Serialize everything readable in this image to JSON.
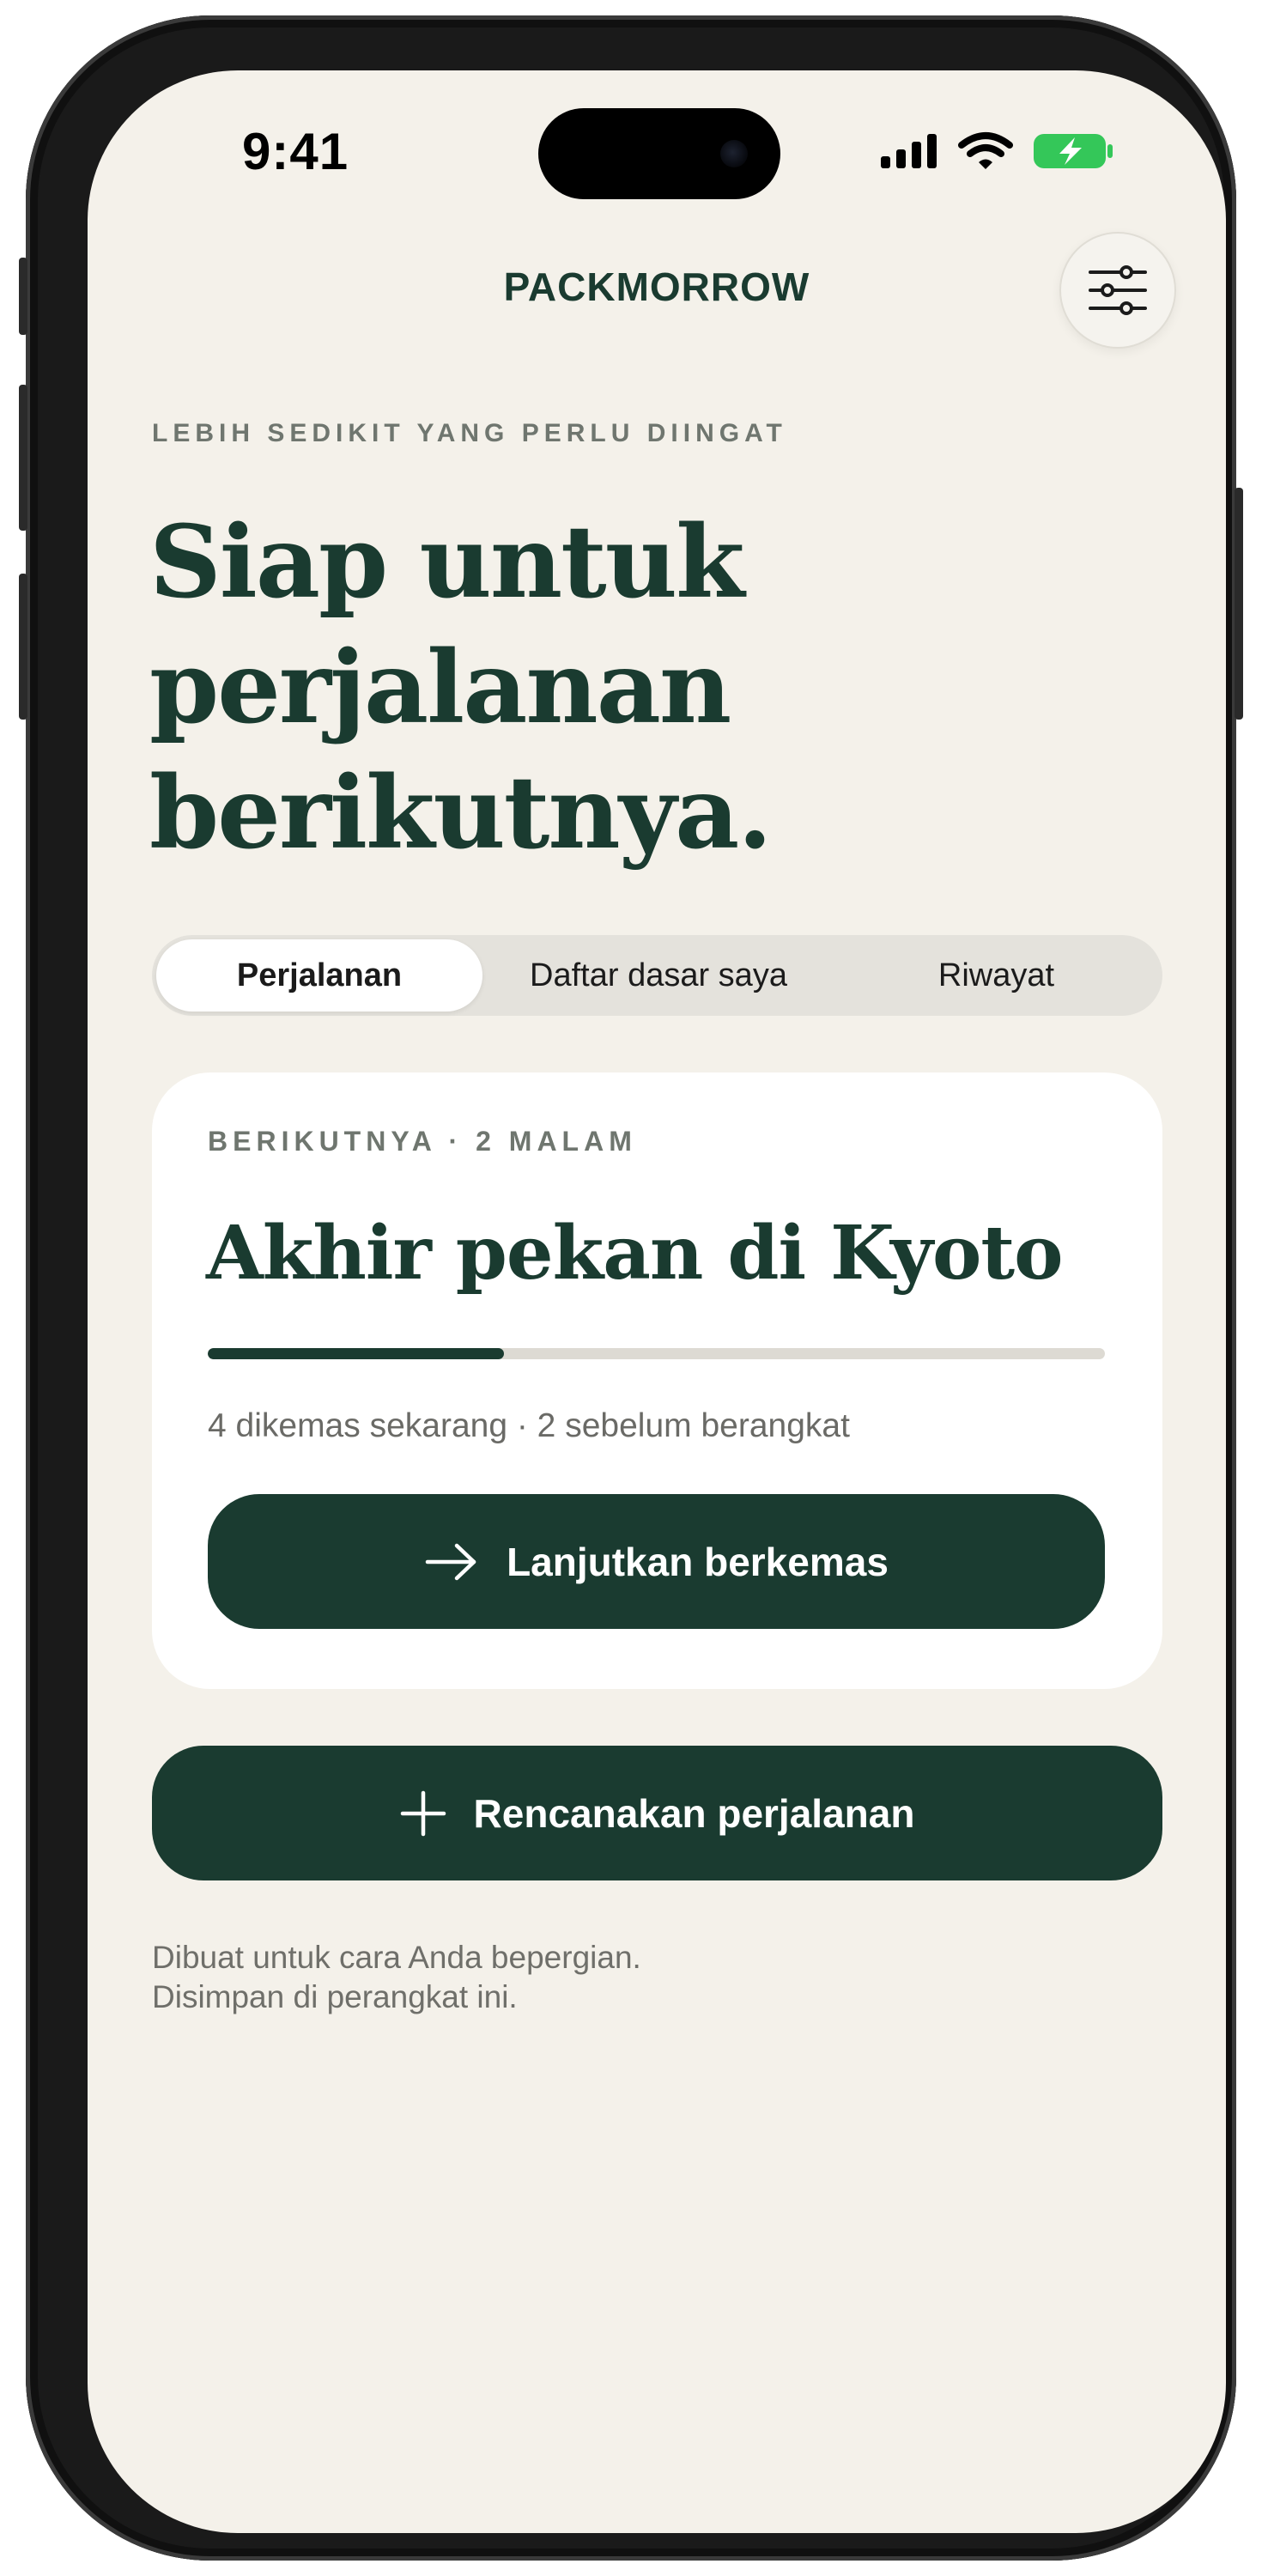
{
  "status_bar": {
    "time": "9:41"
  },
  "header": {
    "brand": "PACKMORROW"
  },
  "hero": {
    "eyebrow": "LEBIH SEDIKIT YANG PERLU DIINGAT",
    "headline_lines": [
      "Siap untuk",
      "perjalanan",
      "berikutnya."
    ]
  },
  "tabs": [
    {
      "label": "Perjalanan",
      "active": true
    },
    {
      "label": "Daftar dasar saya",
      "active": false
    },
    {
      "label": "Riwayat",
      "active": false
    }
  ],
  "trip_card": {
    "eyebrow": "BERIKUTNYA · 2 MALAM",
    "title": "Akhir pekan di Kyoto",
    "progress_fraction": 0.33,
    "meta": "4 dikemas sekarang · 2 sebelum berangkat",
    "continue_label": "Lanjutkan berkemas"
  },
  "plan_button": {
    "label": "Rencanakan perjalanan"
  },
  "footer": {
    "lines": [
      "Dibuat untuk cara Anda bepergian.",
      "Disimpan di perangkat ini."
    ]
  },
  "colors": {
    "background": "#f4f1ea",
    "accent": "#1a3b30",
    "battery": "#34c759"
  },
  "icons": {
    "settings": "sliders-icon",
    "continue": "arrow-right-icon",
    "plan": "plus-icon"
  }
}
